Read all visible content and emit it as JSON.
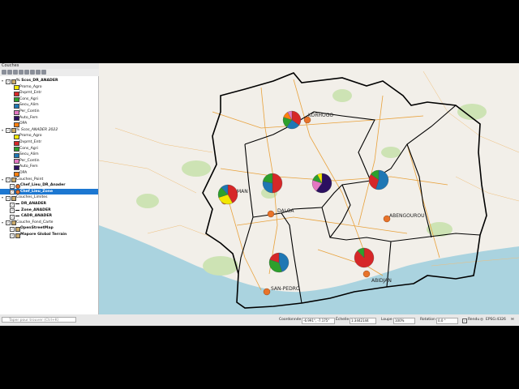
{
  "layers_panel": {
    "title": "Couches",
    "locator_placeholder": "Taper pour trouver (Ctrl+K)",
    "tree": [
      {
        "label": "% Scos_DR_ANADER",
        "bold": true,
        "checked": true,
        "indent": 0,
        "expand": true
      },
      {
        "label": "Promo_Agro",
        "swatch": "#f2e600",
        "indent": 2
      },
      {
        "label": "Dvpmt_Entr",
        "swatch": "#d62728",
        "indent": 2
      },
      {
        "label": "Cons_Agri",
        "swatch": "#2ca02c",
        "indent": 2
      },
      {
        "label": "Secu_Alim",
        "swatch": "#1f77b4",
        "indent": 2
      },
      {
        "label": "Per_Contin",
        "swatch": "#e377c2",
        "indent": 2
      },
      {
        "label": "Auto_Fem",
        "swatch": "#2b1060",
        "indent": 2
      },
      {
        "label": "OPA",
        "swatch": "#ff7f0e",
        "indent": 2
      },
      {
        "label": "% Scos_ANADER 2022",
        "checked": true,
        "indent": 0,
        "expand": true,
        "italic": true
      },
      {
        "label": "Promo_Agro",
        "swatch": "#f2e600",
        "indent": 2
      },
      {
        "label": "Dvpmt_Entr",
        "swatch": "#d62728",
        "indent": 2
      },
      {
        "label": "Cons_Agri",
        "swatch": "#2ca02c",
        "indent": 2
      },
      {
        "label": "Secu_Alim",
        "swatch": "#1f77b4",
        "indent": 2
      },
      {
        "label": "Per_Contin",
        "swatch": "#e377c2",
        "indent": 2
      },
      {
        "label": "Auto_Fem",
        "swatch": "#2b1060",
        "indent": 2
      },
      {
        "label": "OPA",
        "swatch": "#ff7f0e",
        "indent": 2
      },
      {
        "label": "Couches_Point",
        "checked": true,
        "indent": 0,
        "expand": true
      },
      {
        "label": "Chef_Lieu_DR_Anader",
        "bold": true,
        "checked": true,
        "indent": 1,
        "dot": "#e8732a"
      },
      {
        "label": "Chef_Lieu_Zone",
        "bold": true,
        "checked": true,
        "indent": 1,
        "dot": "#e8732a",
        "selected": true
      },
      {
        "label": "Couches_Limites",
        "checked": true,
        "indent": 0,
        "expand": true
      },
      {
        "label": "DR_ANADER",
        "bold": true,
        "checked": true,
        "indent": 1,
        "line": "#000000"
      },
      {
        "label": "Zone_ANADER",
        "bold": true,
        "checked": true,
        "indent": 1,
        "line": "#000000"
      },
      {
        "label": "CADR_ANADER",
        "bold": true,
        "checked": true,
        "indent": 1,
        "line": "#000000"
      },
      {
        "label": "Couche_Fond_Carte",
        "checked": true,
        "indent": 0,
        "expand": true
      },
      {
        "label": "OpenStreetMap",
        "bold": true,
        "checked": true,
        "indent": 1
      },
      {
        "label": "Mapore Global Terrain",
        "bold": true,
        "checked": true,
        "indent": 1
      }
    ]
  },
  "status_bar": {
    "coord_label": "Coordonnée",
    "coord_value": "-6.991°, -7.175°",
    "scale_label": "Échelle",
    "scale_value": "1:3442144",
    "magnifier_label": "Loupe",
    "magnifier_value": "100%",
    "rotation_label": "Rotation",
    "rotation_value": "0,0 °",
    "render_label": "Rendu",
    "crs": "EPSG:4326"
  },
  "map": {
    "city_labels": [
      {
        "id": "korhogo",
        "text": "KORHOGO"
      },
      {
        "id": "man",
        "text": "MAN"
      },
      {
        "id": "daloa",
        "text": "DALOA"
      },
      {
        "id": "abengourou",
        "text": "ABENGOUROU"
      },
      {
        "id": "sanpedro",
        "text": "SAN-PEDRO"
      },
      {
        "id": "abidjan",
        "text": "ABIDJAN"
      }
    ]
  },
  "chart_data": [
    {
      "type": "pie",
      "title": "",
      "categories": [
        "Dvpmt_Entr",
        "Secu_Alim",
        "Cons_Agri",
        "OPA",
        "Per_Contin"
      ],
      "values": [
        35,
        25,
        20,
        12,
        8
      ],
      "location": "KORHOGO"
    },
    {
      "type": "pie",
      "title": "",
      "categories": [
        "Dvpmt_Entr",
        "Secu_Alim",
        "Cons_Agri"
      ],
      "values": [
        50,
        28,
        22
      ],
      "location": "centre-ouest"
    },
    {
      "type": "pie",
      "title": "",
      "categories": [
        "Auto_Fem",
        "Per_Contin",
        "Cons_Agri",
        "Promo_Agro"
      ],
      "values": [
        60,
        20,
        12,
        8
      ],
      "location": "centre"
    },
    {
      "type": "pie",
      "title": "",
      "categories": [
        "Secu_Alim",
        "Dvpmt_Entr",
        "Cons_Agri"
      ],
      "values": [
        55,
        30,
        15
      ],
      "location": "est"
    },
    {
      "type": "pie",
      "title": "",
      "categories": [
        "Dvpmt_Entr",
        "Promo_Agro",
        "Cons_Agri",
        "Secu_Alim"
      ],
      "values": [
        42,
        28,
        18,
        12
      ],
      "location": "MAN"
    },
    {
      "type": "pie",
      "title": "",
      "categories": [
        "Secu_Alim",
        "Cons_Agri",
        "Dvpmt_Entr"
      ],
      "values": [
        45,
        35,
        20
      ],
      "location": "sud-ouest"
    },
    {
      "type": "pie",
      "title": "",
      "categories": [
        "Dvpmt_Entr",
        "Cons_Agri"
      ],
      "values": [
        88,
        12
      ],
      "location": "sud"
    }
  ],
  "colors": {
    "Promo_Agro": "#f2e600",
    "Dvpmt_Entr": "#d62728",
    "Cons_Agri": "#2ca02c",
    "Secu_Alim": "#1f77b4",
    "Per_Contin": "#e377c2",
    "Auto_Fem": "#2b1060",
    "OPA": "#ff7f0e",
    "selection": "#1c77d1",
    "boundary": "#000000",
    "roads": "#e8a13b",
    "sea": "#aad3df",
    "land": "#f2efe9",
    "forest": "#cde3b4",
    "city_marker": "#e8732a"
  }
}
